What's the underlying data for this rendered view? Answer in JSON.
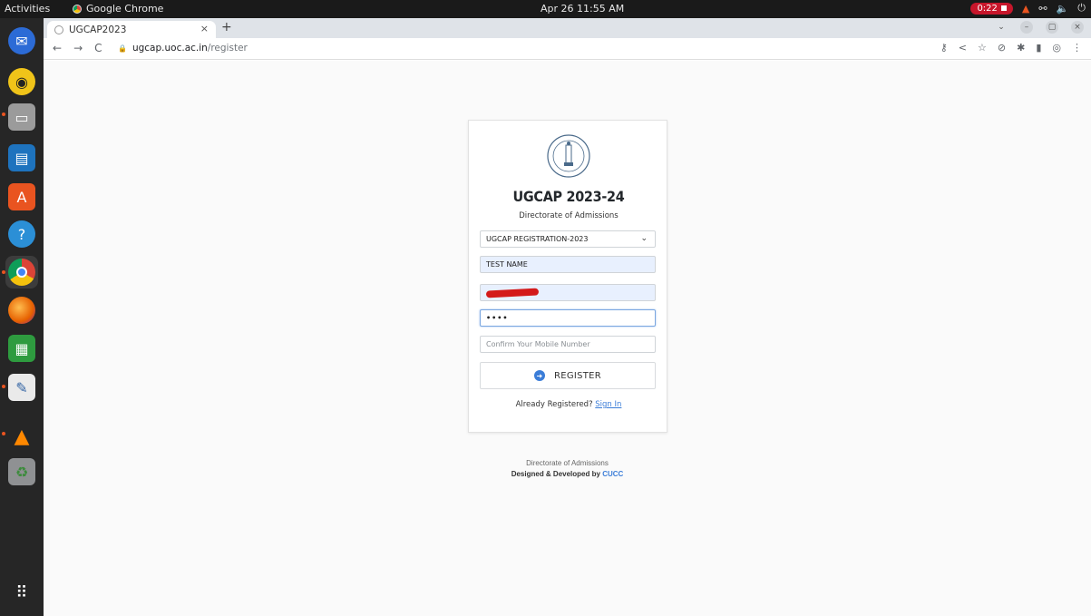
{
  "topbar": {
    "activities": "Activities",
    "app_name": "Google Chrome",
    "clock": "Apr 26  11:55 AM",
    "recording_time": "0:22"
  },
  "dock": {
    "items": [
      {
        "name": "thunderbird-icon"
      },
      {
        "name": "rhythmbox-icon"
      },
      {
        "name": "files-icon"
      },
      {
        "name": "libreoffice-writer-icon"
      },
      {
        "name": "ubuntu-software-icon"
      },
      {
        "name": "help-icon"
      },
      {
        "name": "chrome-icon"
      },
      {
        "name": "firefox-icon"
      },
      {
        "name": "libreoffice-calc-icon"
      },
      {
        "name": "text-editor-icon"
      },
      {
        "name": "vlc-icon"
      },
      {
        "name": "trash-icon"
      },
      {
        "name": "show-apps-icon"
      }
    ]
  },
  "browser": {
    "tab_title": "UGCAP2023",
    "url_host": "ugcap.uoc.ac.in",
    "url_path": "/register"
  },
  "page": {
    "title": "UGCAP 2023-24",
    "subtitle": "Directorate of Admissions",
    "registration_type": {
      "selected": "UGCAP REGISTRATION-2023"
    },
    "name_field": {
      "value": "TEST NAME"
    },
    "mobile_field": {
      "value": "••••"
    },
    "confirm_field": {
      "placeholder": "Confirm Your Mobile Number"
    },
    "register_button": "REGISTER",
    "already_registered": "Already Registered?",
    "sign_in_link": "Sign In",
    "footer_line1": "Directorate of Admissions",
    "footer_line2_prefix": "Designed & Developed by",
    "footer_line2_brand": "CUCC"
  },
  "colors": {
    "accent": "#3b7dd8",
    "autofill_bg": "#e8f0fe",
    "dock_bg": "#262626",
    "recording": "#c7162b"
  }
}
